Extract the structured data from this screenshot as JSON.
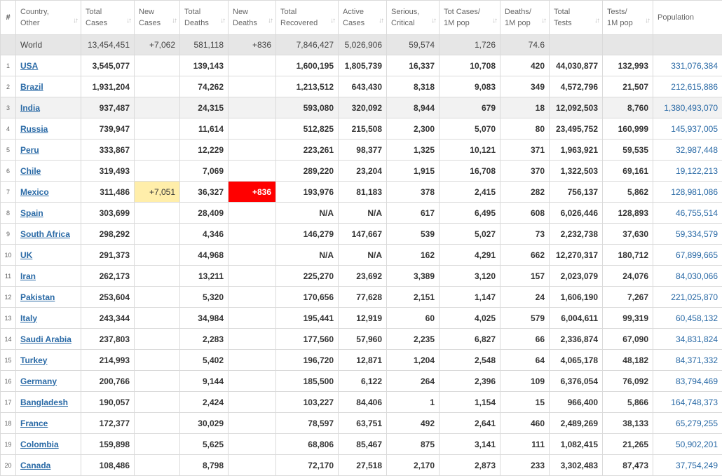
{
  "headers": [
    {
      "line1": "#",
      "line2": ""
    },
    {
      "line1": "Country,",
      "line2": "Other"
    },
    {
      "line1": "Total",
      "line2": "Cases"
    },
    {
      "line1": "New",
      "line2": "Cases"
    },
    {
      "line1": "Total",
      "line2": "Deaths"
    },
    {
      "line1": "New",
      "line2": "Deaths"
    },
    {
      "line1": "Total",
      "line2": "Recovered"
    },
    {
      "line1": "Active",
      "line2": "Cases"
    },
    {
      "line1": "Serious,",
      "line2": "Critical"
    },
    {
      "line1": "Tot Cases/",
      "line2": "1M pop"
    },
    {
      "line1": "Deaths/",
      "line2": "1M pop"
    },
    {
      "line1": "Total",
      "line2": "Tests"
    },
    {
      "line1": "Tests/",
      "line2": "1M pop"
    },
    {
      "line1": "Population",
      "line2": ""
    }
  ],
  "world": {
    "name": "World",
    "total_cases": "13,454,451",
    "new_cases": "+7,062",
    "total_deaths": "581,118",
    "new_deaths": "+836",
    "total_recovered": "7,846,427",
    "active_cases": "5,026,906",
    "serious": "59,574",
    "cases_per_m": "1,726",
    "deaths_per_m": "74.6",
    "total_tests": "",
    "tests_per_m": "",
    "population": ""
  },
  "rows": [
    {
      "idx": "1",
      "name": "USA",
      "total_cases": "3,545,077",
      "new_cases": "",
      "total_deaths": "139,143",
      "new_deaths": "",
      "total_recovered": "1,600,195",
      "active_cases": "1,805,739",
      "serious": "16,337",
      "cases_per_m": "10,708",
      "deaths_per_m": "420",
      "total_tests": "44,030,877",
      "tests_per_m": "132,993",
      "population": "331,076,384"
    },
    {
      "idx": "2",
      "name": "Brazil",
      "total_cases": "1,931,204",
      "new_cases": "",
      "total_deaths": "74,262",
      "new_deaths": "",
      "total_recovered": "1,213,512",
      "active_cases": "643,430",
      "serious": "8,318",
      "cases_per_m": "9,083",
      "deaths_per_m": "349",
      "total_tests": "4,572,796",
      "tests_per_m": "21,507",
      "population": "212,615,886"
    },
    {
      "idx": "3",
      "name": "India",
      "total_cases": "937,487",
      "new_cases": "",
      "total_deaths": "24,315",
      "new_deaths": "",
      "total_recovered": "593,080",
      "active_cases": "320,092",
      "serious": "8,944",
      "cases_per_m": "679",
      "deaths_per_m": "18",
      "total_tests": "12,092,503",
      "tests_per_m": "8,760",
      "population": "1,380,493,070"
    },
    {
      "idx": "4",
      "name": "Russia",
      "total_cases": "739,947",
      "new_cases": "",
      "total_deaths": "11,614",
      "new_deaths": "",
      "total_recovered": "512,825",
      "active_cases": "215,508",
      "serious": "2,300",
      "cases_per_m": "5,070",
      "deaths_per_m": "80",
      "total_tests": "23,495,752",
      "tests_per_m": "160,999",
      "population": "145,937,005"
    },
    {
      "idx": "5",
      "name": "Peru",
      "total_cases": "333,867",
      "new_cases": "",
      "total_deaths": "12,229",
      "new_deaths": "",
      "total_recovered": "223,261",
      "active_cases": "98,377",
      "serious": "1,325",
      "cases_per_m": "10,121",
      "deaths_per_m": "371",
      "total_tests": "1,963,921",
      "tests_per_m": "59,535",
      "population": "32,987,448"
    },
    {
      "idx": "6",
      "name": "Chile",
      "total_cases": "319,493",
      "new_cases": "",
      "total_deaths": "7,069",
      "new_deaths": "",
      "total_recovered": "289,220",
      "active_cases": "23,204",
      "serious": "1,915",
      "cases_per_m": "16,708",
      "deaths_per_m": "370",
      "total_tests": "1,322,503",
      "tests_per_m": "69,161",
      "population": "19,122,213"
    },
    {
      "idx": "7",
      "name": "Mexico",
      "total_cases": "311,486",
      "new_cases": "+7,051",
      "total_deaths": "36,327",
      "new_deaths": "+836",
      "total_recovered": "193,976",
      "active_cases": "81,183",
      "serious": "378",
      "cases_per_m": "2,415",
      "deaths_per_m": "282",
      "total_tests": "756,137",
      "tests_per_m": "5,862",
      "population": "128,981,086"
    },
    {
      "idx": "8",
      "name": "Spain",
      "total_cases": "303,699",
      "new_cases": "",
      "total_deaths": "28,409",
      "new_deaths": "",
      "total_recovered": "N/A",
      "active_cases": "N/A",
      "serious": "617",
      "cases_per_m": "6,495",
      "deaths_per_m": "608",
      "total_tests": "6,026,446",
      "tests_per_m": "128,893",
      "population": "46,755,514"
    },
    {
      "idx": "9",
      "name": "South Africa",
      "total_cases": "298,292",
      "new_cases": "",
      "total_deaths": "4,346",
      "new_deaths": "",
      "total_recovered": "146,279",
      "active_cases": "147,667",
      "serious": "539",
      "cases_per_m": "5,027",
      "deaths_per_m": "73",
      "total_tests": "2,232,738",
      "tests_per_m": "37,630",
      "population": "59,334,579"
    },
    {
      "idx": "10",
      "name": "UK",
      "total_cases": "291,373",
      "new_cases": "",
      "total_deaths": "44,968",
      "new_deaths": "",
      "total_recovered": "N/A",
      "active_cases": "N/A",
      "serious": "162",
      "cases_per_m": "4,291",
      "deaths_per_m": "662",
      "total_tests": "12,270,317",
      "tests_per_m": "180,712",
      "population": "67,899,665"
    },
    {
      "idx": "11",
      "name": "Iran",
      "total_cases": "262,173",
      "new_cases": "",
      "total_deaths": "13,211",
      "new_deaths": "",
      "total_recovered": "225,270",
      "active_cases": "23,692",
      "serious": "3,389",
      "cases_per_m": "3,120",
      "deaths_per_m": "157",
      "total_tests": "2,023,079",
      "tests_per_m": "24,076",
      "population": "84,030,066"
    },
    {
      "idx": "12",
      "name": "Pakistan",
      "total_cases": "253,604",
      "new_cases": "",
      "total_deaths": "5,320",
      "new_deaths": "",
      "total_recovered": "170,656",
      "active_cases": "77,628",
      "serious": "2,151",
      "cases_per_m": "1,147",
      "deaths_per_m": "24",
      "total_tests": "1,606,190",
      "tests_per_m": "7,267",
      "population": "221,025,870"
    },
    {
      "idx": "13",
      "name": "Italy",
      "total_cases": "243,344",
      "new_cases": "",
      "total_deaths": "34,984",
      "new_deaths": "",
      "total_recovered": "195,441",
      "active_cases": "12,919",
      "serious": "60",
      "cases_per_m": "4,025",
      "deaths_per_m": "579",
      "total_tests": "6,004,611",
      "tests_per_m": "99,319",
      "population": "60,458,132"
    },
    {
      "idx": "14",
      "name": "Saudi Arabia",
      "total_cases": "237,803",
      "new_cases": "",
      "total_deaths": "2,283",
      "new_deaths": "",
      "total_recovered": "177,560",
      "active_cases": "57,960",
      "serious": "2,235",
      "cases_per_m": "6,827",
      "deaths_per_m": "66",
      "total_tests": "2,336,874",
      "tests_per_m": "67,090",
      "population": "34,831,824"
    },
    {
      "idx": "15",
      "name": "Turkey",
      "total_cases": "214,993",
      "new_cases": "",
      "total_deaths": "5,402",
      "new_deaths": "",
      "total_recovered": "196,720",
      "active_cases": "12,871",
      "serious": "1,204",
      "cases_per_m": "2,548",
      "deaths_per_m": "64",
      "total_tests": "4,065,178",
      "tests_per_m": "48,182",
      "population": "84,371,332"
    },
    {
      "idx": "16",
      "name": "Germany",
      "total_cases": "200,766",
      "new_cases": "",
      "total_deaths": "9,144",
      "new_deaths": "",
      "total_recovered": "185,500",
      "active_cases": "6,122",
      "serious": "264",
      "cases_per_m": "2,396",
      "deaths_per_m": "109",
      "total_tests": "6,376,054",
      "tests_per_m": "76,092",
      "population": "83,794,469"
    },
    {
      "idx": "17",
      "name": "Bangladesh",
      "total_cases": "190,057",
      "new_cases": "",
      "total_deaths": "2,424",
      "new_deaths": "",
      "total_recovered": "103,227",
      "active_cases": "84,406",
      "serious": "1",
      "cases_per_m": "1,154",
      "deaths_per_m": "15",
      "total_tests": "966,400",
      "tests_per_m": "5,866",
      "population": "164,748,373"
    },
    {
      "idx": "18",
      "name": "France",
      "total_cases": "172,377",
      "new_cases": "",
      "total_deaths": "30,029",
      "new_deaths": "",
      "total_recovered": "78,597",
      "active_cases": "63,751",
      "serious": "492",
      "cases_per_m": "2,641",
      "deaths_per_m": "460",
      "total_tests": "2,489,269",
      "tests_per_m": "38,133",
      "population": "65,279,255"
    },
    {
      "idx": "19",
      "name": "Colombia",
      "total_cases": "159,898",
      "new_cases": "",
      "total_deaths": "5,625",
      "new_deaths": "",
      "total_recovered": "68,806",
      "active_cases": "85,467",
      "serious": "875",
      "cases_per_m": "3,141",
      "deaths_per_m": "111",
      "total_tests": "1,082,415",
      "tests_per_m": "21,265",
      "population": "50,902,201"
    },
    {
      "idx": "20",
      "name": "Canada",
      "total_cases": "108,486",
      "new_cases": "",
      "total_deaths": "8,798",
      "new_deaths": "",
      "total_recovered": "72,170",
      "active_cases": "27,518",
      "serious": "2,170",
      "cases_per_m": "2,873",
      "deaths_per_m": "233",
      "total_tests": "3,302,483",
      "tests_per_m": "87,473",
      "population": "37,754,249"
    }
  ],
  "colors": {
    "link": "#2a6aa6",
    "new_cases_highlight": "#ffeeaa",
    "new_deaths_highlight": "#ff0000",
    "world_row_bg": "#e6e6e6",
    "shaded_row_bg": "#f2f2f2"
  },
  "icons": {
    "sort": "sort-arrows-icon"
  }
}
